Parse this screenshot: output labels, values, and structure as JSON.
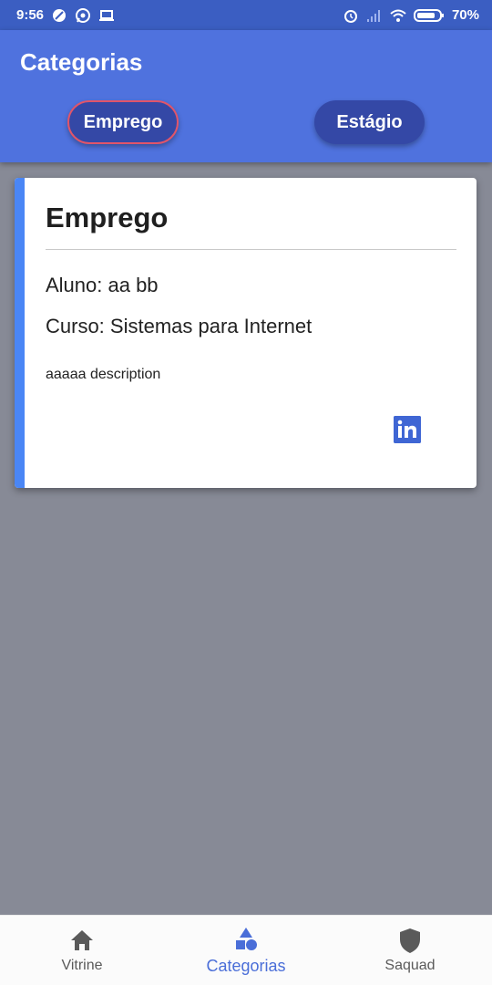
{
  "status_bar": {
    "time": "9:56",
    "battery": "70%",
    "icons": [
      "blocked-icon",
      "whatsapp-icon",
      "laptop-icon",
      "alarm-icon",
      "signal-icon",
      "wifi-icon",
      "battery-icon"
    ]
  },
  "app_bar": {
    "title": "Categorias",
    "filters": [
      {
        "label": "Emprego",
        "selected": true
      },
      {
        "label": "Estágio",
        "selected": false
      }
    ]
  },
  "card": {
    "title": "Emprego",
    "aluno": "Aluno: aa bb",
    "curso": "Curso: Sistemas para Internet",
    "description": "aaaaa description",
    "link_icon": "linkedin-icon"
  },
  "bottom_nav": {
    "items": [
      {
        "label": "Vitrine",
        "icon": "home-icon",
        "active": false
      },
      {
        "label": "Categorias",
        "icon": "shapes-icon",
        "active": true
      },
      {
        "label": "Saquad",
        "icon": "shield-icon",
        "active": false
      }
    ]
  },
  "colors": {
    "status_bar": "#3b5ec2",
    "app_bar": "#4f72de",
    "chip": "#3448a6",
    "chip_selected_border": "#e0556a",
    "card_accent": "#4a86f5",
    "background": "#878a96",
    "nav_active": "#4a6ed8"
  }
}
